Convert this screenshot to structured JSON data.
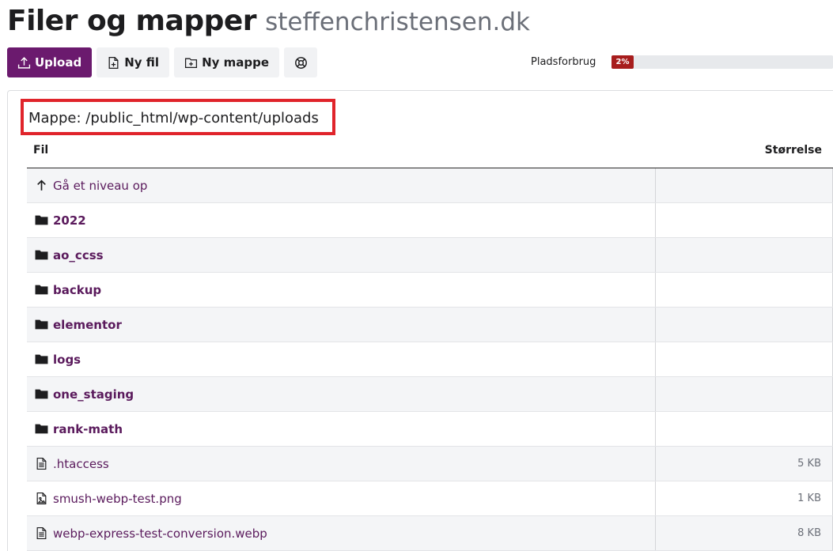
{
  "header": {
    "title": "Filer og mapper",
    "domain": "steffenchristensen.dk"
  },
  "toolbar": {
    "upload_label": "Upload",
    "new_file_label": "Ny fil",
    "new_folder_label": "Ny mappe"
  },
  "usage": {
    "label": "Pladsforbrug",
    "value_text": "2%",
    "percent": 2,
    "bar_color": "#a71d1d"
  },
  "folder_path": "Mappe: /public_html/wp-content/uploads",
  "table": {
    "col_file": "Fil",
    "col_size": "Størrelse",
    "rows": [
      {
        "type": "up",
        "name": "Gå et niveau op",
        "size": "",
        "icon": "arrow-up-icon"
      },
      {
        "type": "folder",
        "name": "2022",
        "size": "",
        "icon": "folder-icon"
      },
      {
        "type": "folder",
        "name": "ao_ccss",
        "size": "",
        "icon": "folder-icon"
      },
      {
        "type": "folder",
        "name": "backup",
        "size": "",
        "icon": "folder-icon"
      },
      {
        "type": "folder",
        "name": "elementor",
        "size": "",
        "icon": "folder-icon"
      },
      {
        "type": "folder",
        "name": "logs",
        "size": "",
        "icon": "folder-icon"
      },
      {
        "type": "folder",
        "name": "one_staging",
        "size": "",
        "icon": "folder-icon"
      },
      {
        "type": "folder",
        "name": "rank-math",
        "size": "",
        "icon": "folder-icon"
      },
      {
        "type": "file",
        "name": ".htaccess",
        "size": "5 KB",
        "icon": "text-file-icon"
      },
      {
        "type": "image",
        "name": "smush-webp-test.png",
        "size": "1 KB",
        "icon": "image-file-icon"
      },
      {
        "type": "file",
        "name": "webp-express-test-conversion.webp",
        "size": "8 KB",
        "icon": "text-file-icon"
      }
    ]
  },
  "colors": {
    "primary": "#6b1a6e",
    "link": "#5a1a5c",
    "highlight_border": "#e0242b"
  }
}
